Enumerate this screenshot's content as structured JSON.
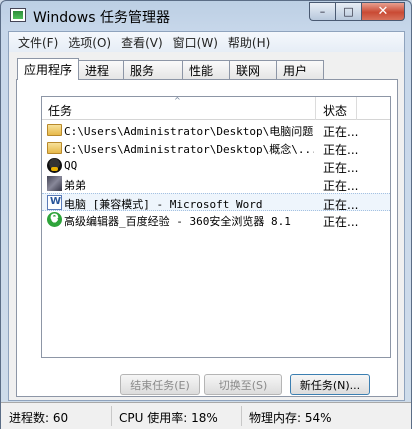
{
  "window": {
    "title": "Windows 任务管理器",
    "minimize_glyph": "–",
    "maximize_glyph": "□",
    "close_glyph": "✕"
  },
  "menu": [
    {
      "label": "文件(F)"
    },
    {
      "label": "选项(O)"
    },
    {
      "label": "查看(V)"
    },
    {
      "label": "窗口(W)"
    },
    {
      "label": "帮助(H)"
    }
  ],
  "tabs": [
    {
      "label": "应用程序",
      "active": true
    },
    {
      "label": "进程"
    },
    {
      "label": "服务"
    },
    {
      "label": "性能"
    },
    {
      "label": "联网"
    },
    {
      "label": "用户"
    }
  ],
  "list": {
    "columns": {
      "task": "任务",
      "status": "状态"
    },
    "sort_glyph": "^",
    "rows": [
      {
        "icon": "folder-icon",
        "task": "C:\\Users\\Administrator\\Desktop\\电脑问题",
        "status": "正在..."
      },
      {
        "icon": "folder-icon",
        "task": "C:\\Users\\Administrator\\Desktop\\概念\\...",
        "status": "正在..."
      },
      {
        "icon": "qq-icon",
        "task": "QQ",
        "status": "正在..."
      },
      {
        "icon": "avatar-icon",
        "task": "弟弟",
        "status": "正在..."
      },
      {
        "icon": "word-icon",
        "task": "电脑 [兼容模式] - Microsoft Word",
        "status": "正在...",
        "selected": true
      },
      {
        "icon": "browser-360-icon",
        "task": "高级编辑器_百度经验 - 360安全浏览器 8.1",
        "status": "正在..."
      }
    ]
  },
  "buttons": {
    "end_task": "结束任务(E)",
    "switch_to": "切换至(S)",
    "new_task": "新任务(N)..."
  },
  "status_bar": {
    "processes": "进程数: 60",
    "cpu": "CPU 使用率: 18%",
    "memory": "物理内存: 54%"
  }
}
